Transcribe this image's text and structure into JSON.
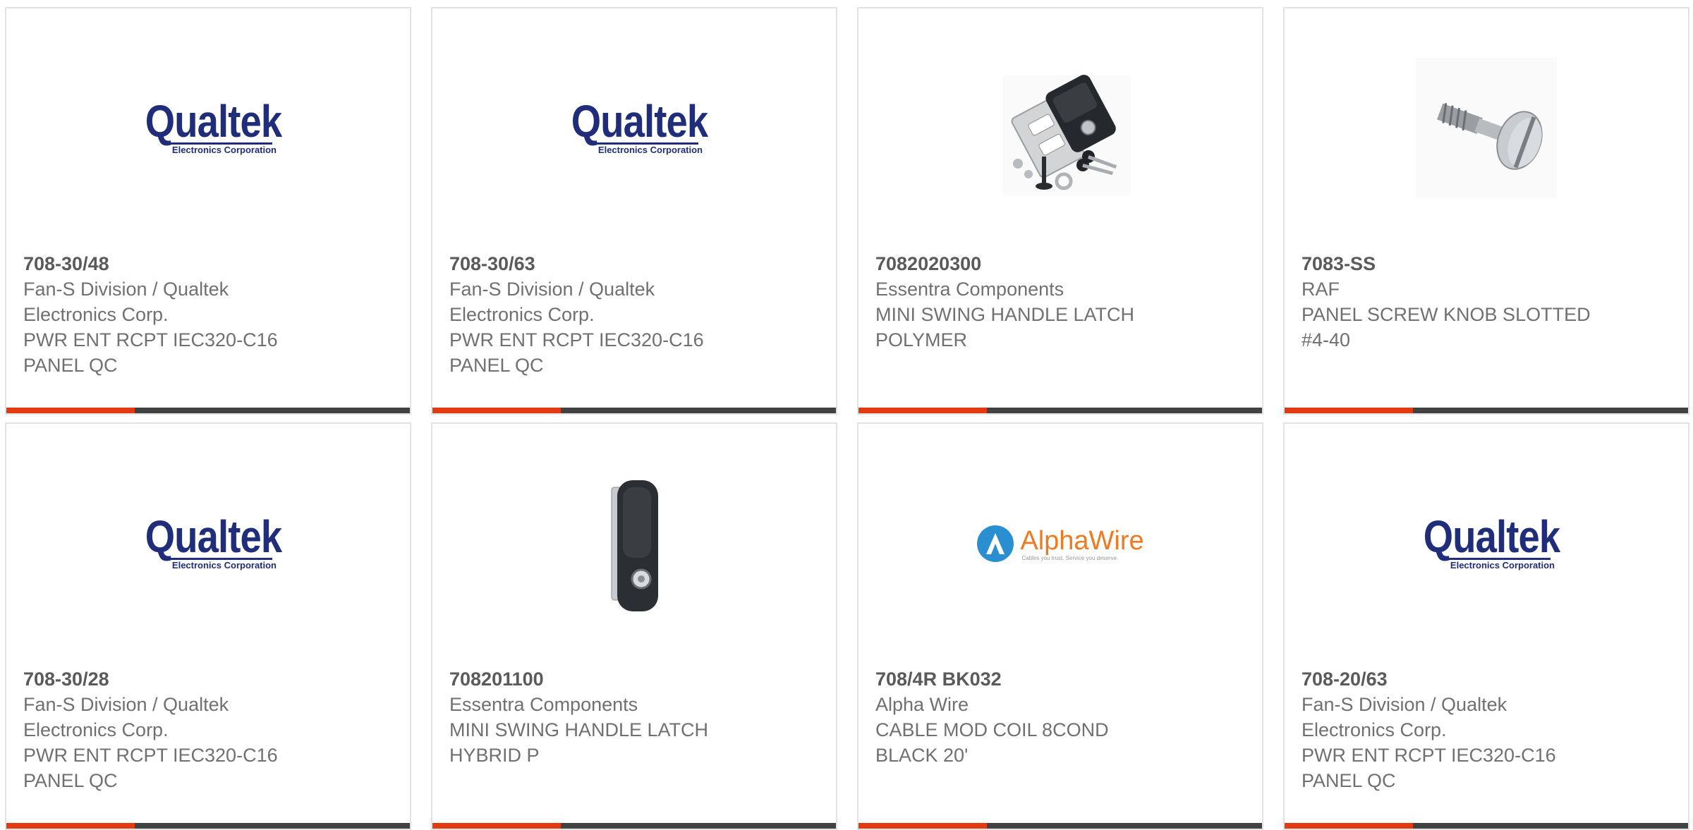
{
  "products": [
    {
      "part_number": "708-30/48",
      "manufacturer": "Fan-S Division / Qualtek Electronics Corp.",
      "description": "PWR ENT RCPT IEC320-C16 PANEL QC",
      "image": "qualtek-logo"
    },
    {
      "part_number": "708-30/63",
      "manufacturer": "Fan-S Division / Qualtek Electronics Corp.",
      "description": "PWR ENT RCPT IEC320-C16 PANEL QC",
      "image": "qualtek-logo"
    },
    {
      "part_number": "7082020300",
      "manufacturer": "Essentra Components",
      "description": "MINI SWING HANDLE LATCH POLYMER",
      "image": "swing-handle-latch-kit"
    },
    {
      "part_number": "7083-SS",
      "manufacturer": "RAF",
      "description": "PANEL SCREW KNOB SLOTTED #4-40",
      "image": "panel-screw-knob"
    },
    {
      "part_number": "708-30/28",
      "manufacturer": "Fan-S Division / Qualtek Electronics Corp.",
      "description": "PWR ENT RCPT IEC320-C16 PANEL QC",
      "image": "qualtek-logo"
    },
    {
      "part_number": "708201100",
      "manufacturer": "Essentra Components",
      "description": "MINI SWING HANDLE LATCH HYBRID P",
      "image": "swing-handle-latch"
    },
    {
      "part_number": "708/4R BK032",
      "manufacturer": "Alpha Wire",
      "description": "CABLE MOD COIL 8COND BLACK 20'",
      "image": "alphawire-logo"
    },
    {
      "part_number": "708-20/63",
      "manufacturer": "Fan-S Division / Qualtek Electronics Corp.",
      "description": "PWR ENT RCPT IEC320-C16 PANEL QC",
      "image": "qualtek-logo"
    }
  ],
  "logos": {
    "qualtek_word": "Qualtek",
    "qualtek_sub": "Electronics Corporation",
    "alphawire_word": "AlphaWire",
    "alphawire_tagline": "Cables you trust. Service you deserve."
  },
  "colors": {
    "accent": "#e33b11",
    "bar": "#3f4143",
    "qualtek_blue": "#1f2d7a",
    "alphawire_orange": "#f07a22",
    "alphawire_blue": "#2a8fd0"
  }
}
